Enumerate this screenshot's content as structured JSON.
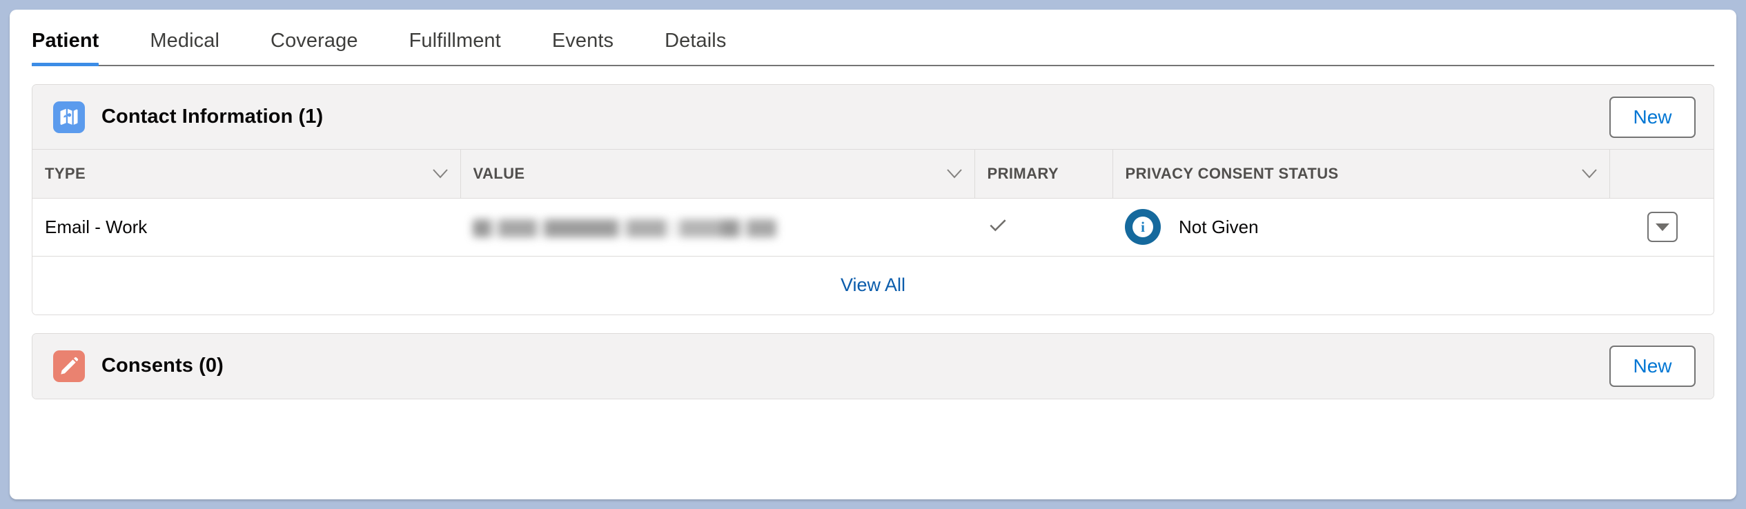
{
  "tabs": [
    {
      "label": "Patient",
      "active": true
    },
    {
      "label": "Medical",
      "active": false
    },
    {
      "label": "Coverage",
      "active": false
    },
    {
      "label": "Fulfillment",
      "active": false
    },
    {
      "label": "Events",
      "active": false
    },
    {
      "label": "Details",
      "active": false
    }
  ],
  "contact_card": {
    "title": "Contact Information (1)",
    "icon": "map-icon",
    "icon_color": "#5b9bed",
    "new_label": "New",
    "columns": [
      {
        "label": "TYPE",
        "sortable": true
      },
      {
        "label": "VALUE",
        "sortable": true
      },
      {
        "label": "PRIMARY",
        "sortable": false
      },
      {
        "label": "PRIVACY CONSENT STATUS",
        "sortable": true
      }
    ],
    "rows": [
      {
        "type": "Email - Work",
        "value": "",
        "value_redacted": true,
        "primary": true,
        "primary_icon": "check-icon",
        "consent_icon": "info-icon",
        "consent_icon_color": "#15699d",
        "consent_status": "Not Given",
        "row_menu_icon": "chevron-down-icon"
      }
    ],
    "footer_link": "View All"
  },
  "consents_card": {
    "title": "Consents (0)",
    "icon": "pencil-icon",
    "icon_color": "#ea8270",
    "new_label": "New"
  },
  "colors": {
    "accent_blue": "#0176d3",
    "tab_underline": "#3c8ce6",
    "link_blue": "#0b5cab",
    "header_gray": "#f3f2f2",
    "border_gray": "#dddbda",
    "page_backdrop": "#aebfdb"
  }
}
